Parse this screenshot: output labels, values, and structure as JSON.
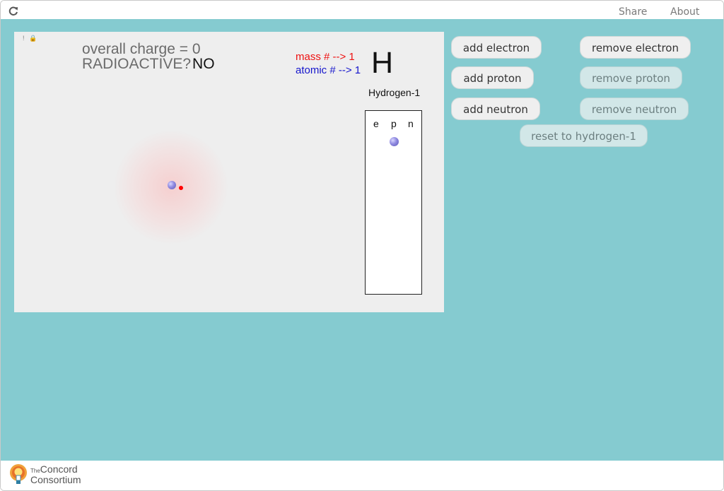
{
  "topbar": {
    "share_label": "Share",
    "about_label": "About"
  },
  "sim": {
    "charge_text": "overall charge = 0",
    "radioactive_label": "RADIOACTIVE?",
    "radioactive_value": "NO",
    "mass_text": "mass # --> 1",
    "atomic_text": "atomic # --> 1",
    "element_symbol": "H",
    "isotope_name": "Hydrogen-1",
    "particle_box": {
      "headers": [
        "e",
        "p",
        "n"
      ]
    },
    "colors": {
      "mass": "#ee1111",
      "atomic": "#1515cc",
      "electron": "#ff0000",
      "proton": "#8f8ae0"
    }
  },
  "controls": {
    "add_electron": "add electron",
    "remove_electron": "remove electron",
    "add_proton": "add proton",
    "remove_proton": "remove proton",
    "add_neutron": "add neutron",
    "remove_neutron": "remove neutron",
    "reset": "reset to hydrogen-1"
  },
  "footer": {
    "logo_the": "The",
    "logo_concord": "Concord",
    "logo_consortium": "Consortium"
  },
  "icons": [
    "reload-icon",
    "info-icon",
    "lock-icon",
    "concord-logo-icon"
  ],
  "theme": {
    "background": "#85cbd0",
    "panel": "#eeeeee"
  }
}
